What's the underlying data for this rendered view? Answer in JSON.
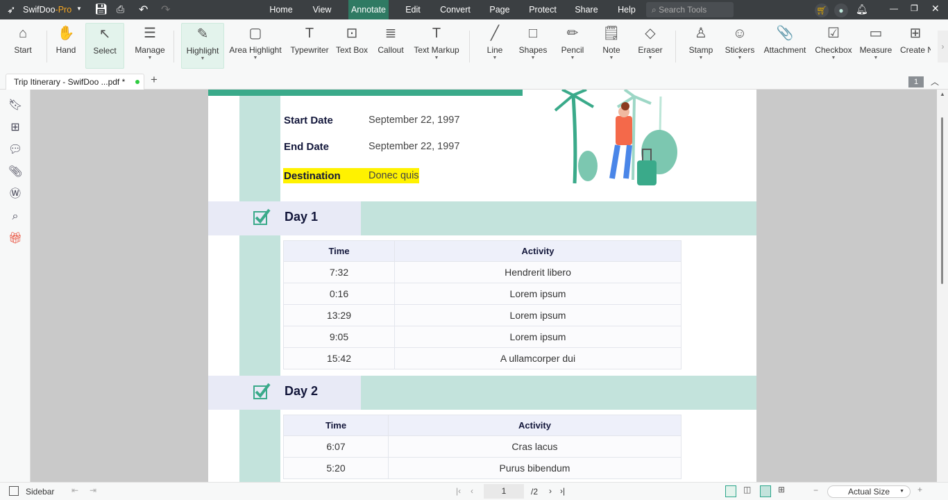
{
  "app": {
    "brand": "SwifDoo",
    "brand_suffix": "-Pro",
    "search_placeholder": "Search Tools"
  },
  "menu": [
    {
      "label": "Home"
    },
    {
      "label": "View"
    },
    {
      "label": "Annotate",
      "active": true
    },
    {
      "label": "Edit"
    },
    {
      "label": "Convert"
    },
    {
      "label": "Page"
    },
    {
      "label": "Protect"
    },
    {
      "label": "Share"
    },
    {
      "label": "Help"
    }
  ],
  "toolbar": [
    {
      "label": "Start",
      "icon": "home-icon",
      "glyph": "⌂"
    },
    {
      "label": "Hand",
      "icon": "hand-icon",
      "glyph": "✋"
    },
    {
      "label": "Select",
      "icon": "cursor-icon",
      "glyph": "↖",
      "active": true
    },
    {
      "label": "Manage",
      "icon": "manage-icon",
      "glyph": "☰",
      "dropdown": true
    },
    {
      "label": "Highlight",
      "icon": "highlighter-icon",
      "glyph": "✎",
      "dropdown": true,
      "active": true
    },
    {
      "label": "Area Highlight",
      "icon": "area-highlight-icon",
      "glyph": "▢",
      "dropdown": true
    },
    {
      "label": "Typewriter",
      "icon": "typewriter-icon",
      "glyph": "T"
    },
    {
      "label": "Text Box",
      "icon": "text-box-icon",
      "glyph": "⊡"
    },
    {
      "label": "Callout",
      "icon": "callout-icon",
      "glyph": "≣"
    },
    {
      "label": "Text Markup",
      "icon": "text-markup-icon",
      "glyph": "T",
      "dropdown": true
    },
    {
      "label": "Line",
      "icon": "line-icon",
      "glyph": "╱",
      "dropdown": true
    },
    {
      "label": "Shapes",
      "icon": "shapes-icon",
      "glyph": "□",
      "dropdown": true
    },
    {
      "label": "Pencil",
      "icon": "pencil-icon",
      "glyph": "✏",
      "dropdown": true
    },
    {
      "label": "Note",
      "icon": "note-icon",
      "glyph": "🗒",
      "dropdown": true
    },
    {
      "label": "Eraser",
      "icon": "eraser-icon",
      "glyph": "◇",
      "dropdown": true
    },
    {
      "label": "Stamp",
      "icon": "stamp-icon",
      "glyph": "♙",
      "dropdown": true
    },
    {
      "label": "Stickers",
      "icon": "sticker-icon",
      "glyph": "☺",
      "dropdown": true
    },
    {
      "label": "Attachment",
      "icon": "paperclip-icon",
      "glyph": "📎"
    },
    {
      "label": "Checkbox",
      "icon": "checkbox-icon",
      "glyph": "☑",
      "dropdown": true
    },
    {
      "label": "Measure",
      "icon": "ruler-icon",
      "glyph": "▭",
      "dropdown": true
    },
    {
      "label": "Create N",
      "icon": "create-new-icon",
      "glyph": "⊞"
    }
  ],
  "tab": {
    "title": "Trip Itinerary - SwifDoo  ...pdf *",
    "page_badge": "1"
  },
  "doc": {
    "start_label": "Start Date",
    "start_value": "September 22, 1997",
    "end_label": "End Date",
    "end_value": "September 22, 1997",
    "dest_label": "Destination",
    "dest_value": "Donec quis",
    "days": [
      {
        "title": "Day 1",
        "headers": [
          "Time",
          "Activity"
        ],
        "rows": [
          [
            "7:32",
            "Hendrerit libero"
          ],
          [
            "0:16",
            "Lorem ipsum"
          ],
          [
            "13:29",
            "Lorem ipsum"
          ],
          [
            "9:05",
            "Lorem ipsum"
          ],
          [
            "15:42",
            "A ullamcorper dui"
          ]
        ]
      },
      {
        "title": "Day 2",
        "headers": [
          "Time",
          "Activity"
        ],
        "rows": [
          [
            "6:07",
            "Cras lacus"
          ],
          [
            "5:20",
            "Purus bibendum"
          ]
        ]
      }
    ],
    "colors": {
      "accent": "#3aaa8a",
      "band": "#c3e3dc",
      "lavender": "#e8eaf6",
      "highlight": "#fff200"
    }
  },
  "status": {
    "sidebar": "Sidebar",
    "current_page": "1",
    "total_pages": "/2",
    "zoom": "Actual Size"
  }
}
